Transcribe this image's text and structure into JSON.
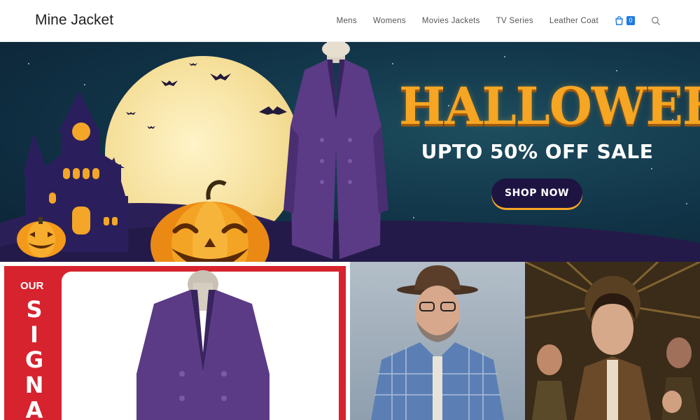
{
  "header": {
    "logo": "Mine Jacket",
    "nav": [
      "Mens",
      "Womens",
      "Movies Jackets",
      "TV Series",
      "Leather Coat"
    ],
    "cart_count": "0"
  },
  "hero": {
    "headline": "HALLOWEEN",
    "subheadline": "UPTO 50% OFF SALE",
    "cta": "SHOP NOW"
  },
  "tiles": {
    "signature_top": "OUR",
    "signature_letters": [
      "S",
      "I",
      "G",
      "N",
      "A"
    ]
  },
  "colors": {
    "accent_blue": "#1f7ae0",
    "halloween_orange": "#f6a623",
    "signature_red": "#d6232e",
    "coat_purple": "#5b3a86"
  }
}
